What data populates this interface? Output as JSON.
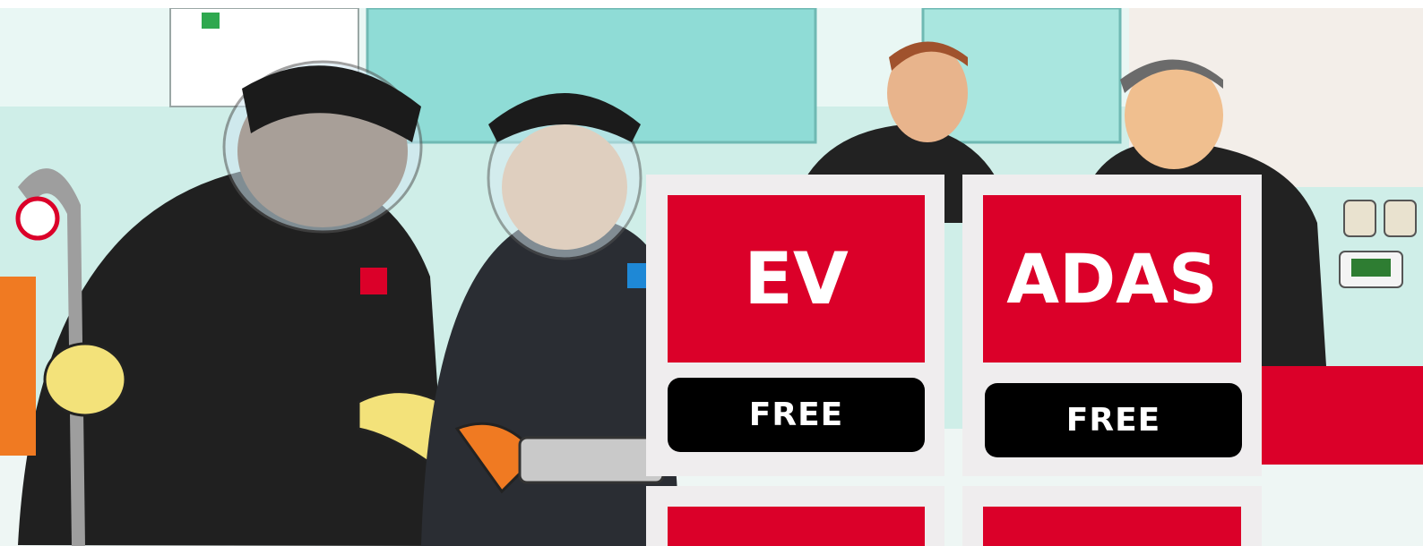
{
  "hero": {
    "illustration": "cartoon-workshop-technicians",
    "colors": {
      "wall": "#bfe7e0",
      "uniform": "#1f1f1f",
      "glove": "#f3e27a",
      "accent": "#db0029"
    }
  },
  "cards": [
    {
      "title": "EV",
      "button_label": "FREE"
    },
    {
      "title": "ADAS",
      "button_label": "FREE"
    },
    {
      "title": "",
      "button_label": ""
    },
    {
      "title": "",
      "button_label": ""
    }
  ],
  "colors": {
    "tile_red": "#db0029",
    "card_bg": "#efedee",
    "button_black": "#000000",
    "text_white": "#ffffff"
  }
}
